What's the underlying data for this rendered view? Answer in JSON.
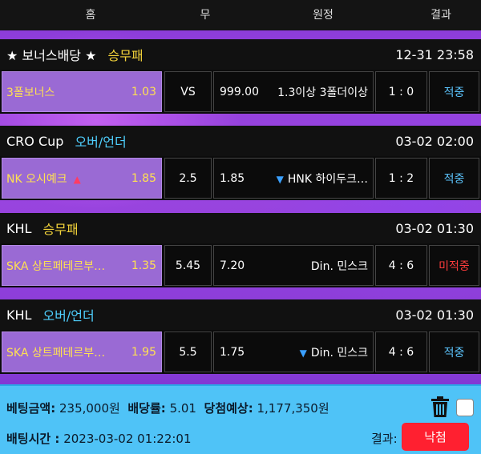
{
  "header": {
    "home": "홈",
    "draw": "무",
    "away": "원정",
    "result": "결과"
  },
  "sections": [
    {
      "league": "★ 보너스배당 ★",
      "type": "승무패",
      "time": "12-31 23:58",
      "home": "3폴보너스",
      "home_odds": "1.03",
      "draw": "VS",
      "away_odds": "999.00",
      "away": "1.3이상 3폴더이상",
      "score": "1 : 0",
      "result": "적중"
    },
    {
      "league": "CRO Cup",
      "type": "오버/언더",
      "time": "03-02 02:00",
      "home": "NK 오시예크",
      "home_odds": "1.85",
      "draw": "2.5",
      "away_odds": "1.85",
      "away": "HNK 하이두크…",
      "score": "1 : 2",
      "result": "적중"
    },
    {
      "league": "KHL",
      "type": "승무패",
      "time": "03-02 01:30",
      "home": "SKA 상트페테르부…",
      "home_odds": "1.35",
      "draw": "5.45",
      "away_odds": "7.20",
      "away": "Din. 민스크",
      "score": "4 : 6",
      "result": "미적중"
    },
    {
      "league": "KHL",
      "type": "오버/언더",
      "time": "03-02 01:30",
      "home": "SKA 상트페테르부…",
      "home_odds": "1.95",
      "draw": "5.5",
      "away_odds": "1.75",
      "away": "Din. 민스크",
      "score": "4 : 6",
      "result": "적중"
    }
  ],
  "footer": {
    "amount_label": "베팅금액:",
    "amount": "235,000원",
    "rate_label": "배당률:",
    "rate": "5.01",
    "expected_label": "당첨예상:",
    "expected": "1,177,350원",
    "time_label": "배팅시간 :",
    "time": "2023-03-02 01:22:01",
    "result_label": "결과:",
    "result_value": "낙첨"
  },
  "icons": {
    "up": "arrow-up-icon",
    "down": "arrow-down-icon",
    "trash": "trash-icon"
  },
  "colors": {
    "win": "#5cc6ff",
    "miss": "#ff3c3c",
    "lose_button": "#ff2030",
    "type_1x2": "#f3d33a",
    "type_ou": "#4fd0ff"
  }
}
